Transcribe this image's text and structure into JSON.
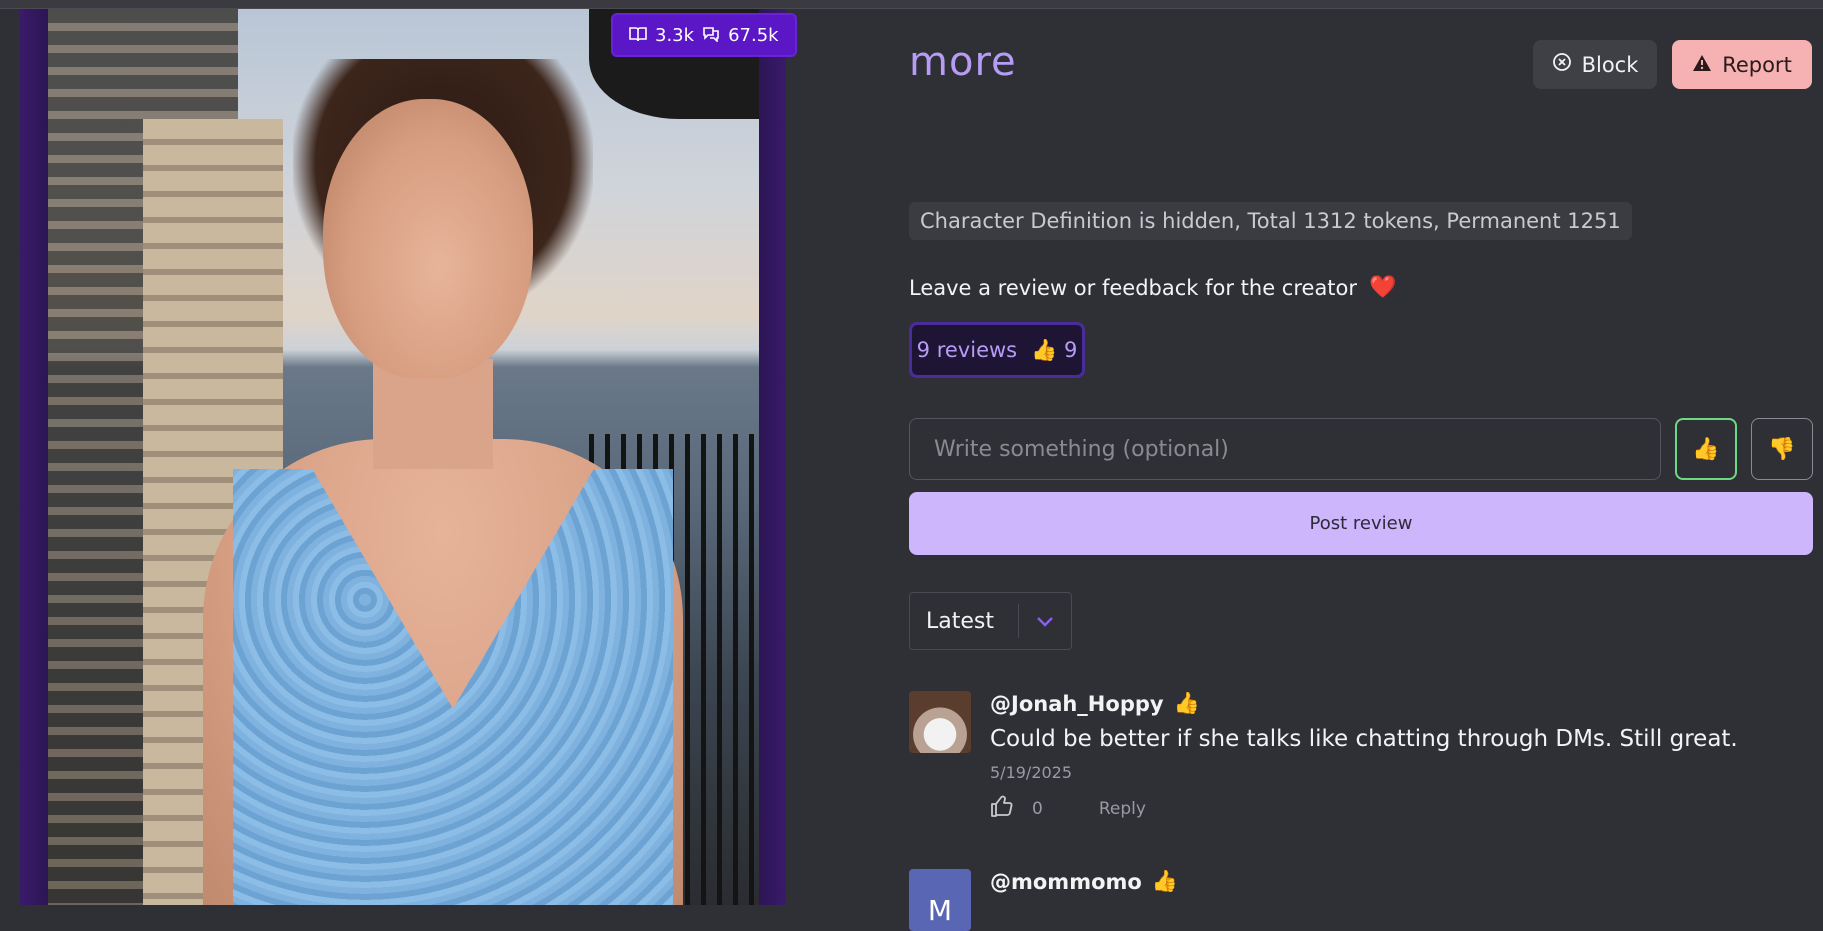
{
  "character_image": {
    "stats": {
      "chats": "3.3k",
      "messages": "67.5k"
    }
  },
  "header": {
    "title": "more",
    "block_label": "Block",
    "report_label": "Report"
  },
  "definition_note": "Character Definition is hidden, Total 1312 tokens, Permanent 1251",
  "feedback": {
    "label": "Leave a review or feedback for the creator",
    "heart": "❤️",
    "reviews_count_label": "9 reviews",
    "thumbs_up_count": "9"
  },
  "review_form": {
    "placeholder": "Write something (optional)",
    "post_label": "Post review"
  },
  "sort": {
    "selected": "Latest"
  },
  "reviews": [
    {
      "user": "@Jonah_Hoppy",
      "text": "Could be better if she talks like chatting through DMs. Still great.",
      "date": "5/19/2025",
      "likes": "0",
      "reply_label": "Reply"
    },
    {
      "user": "@mommomo",
      "avatar_letter": "M"
    }
  ],
  "icons": {
    "book": "book-icon",
    "chat": "chat-icon",
    "block": "circle-x-icon",
    "report": "warning-icon",
    "thumbs_up": "thumbs-up-icon",
    "thumbs_down": "thumbs-down-icon",
    "chevron": "chevron-down-icon"
  },
  "colors": {
    "accent": "#b69cf5",
    "badge": "#5b16c6",
    "report_bg": "#f6b2b3",
    "post_bg": "#cdb6fb",
    "thumb_up": "#7ee074"
  }
}
